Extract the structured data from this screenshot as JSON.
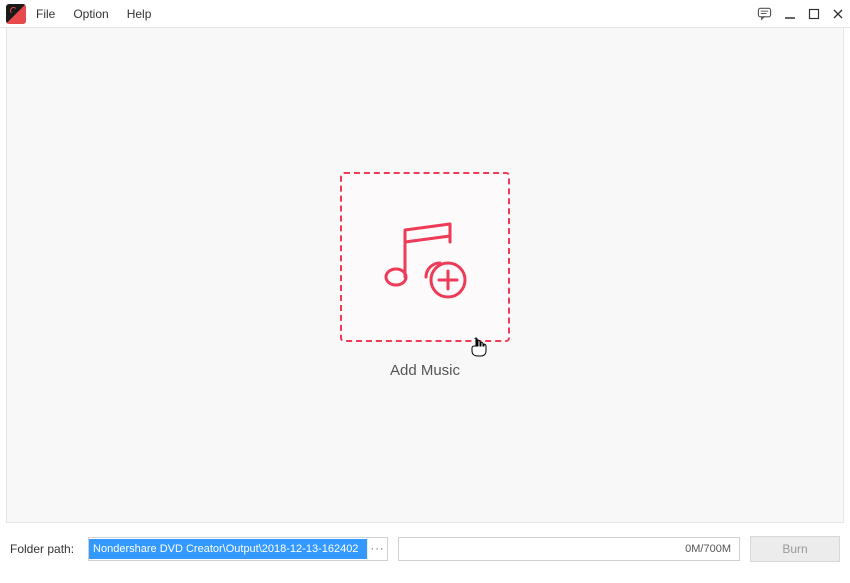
{
  "menu": {
    "file": "File",
    "option": "Option",
    "help": "Help"
  },
  "main": {
    "add_music_label": "Add Music"
  },
  "footer": {
    "folder_label": "Folder path:",
    "folder_value": "Nondershare DVD Creator\\Output\\2018-12-13-162402",
    "browse_label": "···",
    "progress_text": "0M/700M",
    "burn_label": "Burn"
  }
}
